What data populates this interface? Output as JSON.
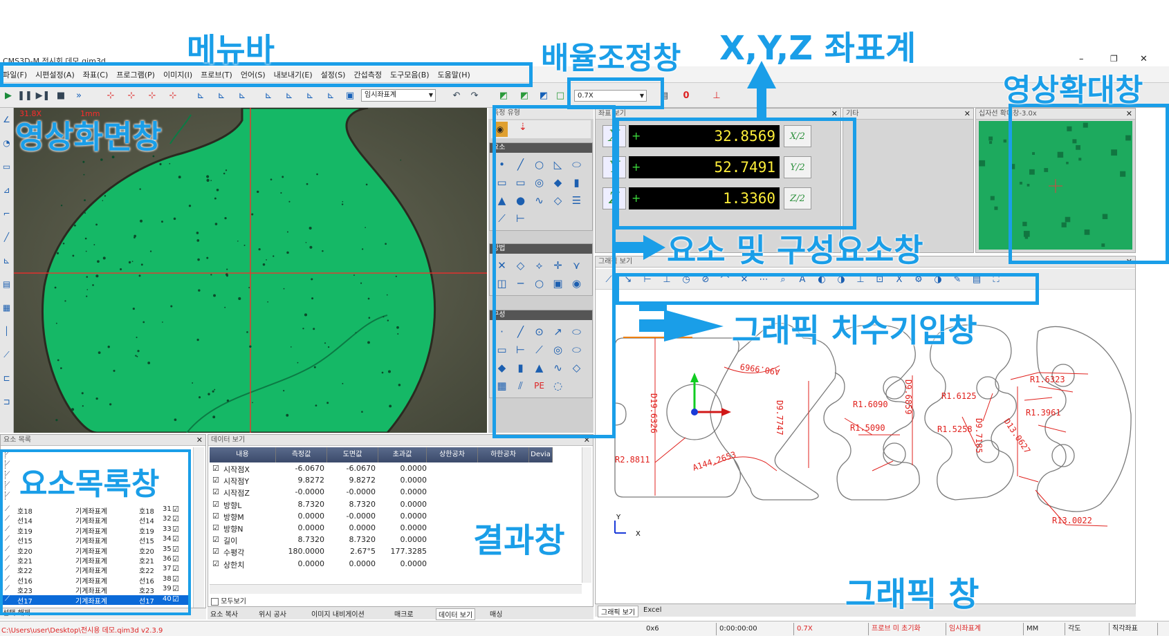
{
  "window": {
    "title": "CMS3D-M  전시회 데모.qim3d",
    "min": "–",
    "max": "❐",
    "close": "✕"
  },
  "menu": [
    "파일(F)",
    "시편설정(A)",
    "좌표(C)",
    "프로그램(P)",
    "이미지(I)",
    "프로브(T)",
    "언어(S)",
    "내보내기(E)",
    "설정(S)",
    "간섭측정",
    "도구모음(B)",
    "도움말(H)"
  ],
  "toolbar": {
    "coord_select": "임시좌표계",
    "zoom_select": "0.7X",
    "zero": "0"
  },
  "image_view": {
    "overlay_mag": "31.8X",
    "overlay_scale": "1mm"
  },
  "measure_panel": {
    "title": "측정 유형",
    "sec1": "요소",
    "sec2": "방법",
    "sec3": "구성",
    "pe": "PE"
  },
  "coord_panel": {
    "title": "좌표 보기",
    "rows": [
      {
        "axis": "X",
        "value": "32.8569",
        "half": "X/2"
      },
      {
        "axis": "Y",
        "value": "52.7491",
        "half": "Y/2"
      },
      {
        "axis": "Z",
        "value": "1.3360",
        "half": "Z/2"
      }
    ]
  },
  "etc_panel": {
    "title": "기타"
  },
  "zoom_panel": {
    "title": "십자선 확대창-3.0x"
  },
  "graphics_panel": {
    "title": "그래픽 보기",
    "dims": {
      "d1": "D19.6326",
      "r1": "R2.8811",
      "a1": "A144.2653",
      "a2": "A90.9969",
      "d2": "D9.7747",
      "r2": "R1.6090",
      "r3": "R1.5090",
      "d3": "D9.6859",
      "r4": "R1.6125",
      "r5": "R1.5258",
      "d4": "D9.7185",
      "d5": "D13.0627",
      "r6": "R1.6323",
      "r7": "R1.3961",
      "r8": "R13.0022"
    },
    "axis_x": "X",
    "axis_y": "Y",
    "tabs": [
      "그래픽 보기",
      "Excel"
    ]
  },
  "element_list": {
    "title": "요소 목록",
    "rows": [
      {
        "name": "호18",
        "coord": "기계좌표계",
        "ref": "호18",
        "no": "31"
      },
      {
        "name": "선14",
        "coord": "기계좌표계",
        "ref": "선14",
        "no": "32"
      },
      {
        "name": "호19",
        "coord": "기계좌표계",
        "ref": "호19",
        "no": "33"
      },
      {
        "name": "선15",
        "coord": "기계좌표계",
        "ref": "선15",
        "no": "34"
      },
      {
        "name": "호20",
        "coord": "기계좌표계",
        "ref": "호20",
        "no": "35"
      },
      {
        "name": "호21",
        "coord": "기계좌표계",
        "ref": "호21",
        "no": "36"
      },
      {
        "name": "호22",
        "coord": "기계좌표계",
        "ref": "호22",
        "no": "37"
      },
      {
        "name": "선16",
        "coord": "기계좌표계",
        "ref": "선16",
        "no": "38"
      },
      {
        "name": "호23",
        "coord": "기계좌표계",
        "ref": "호23",
        "no": "39"
      },
      {
        "name": "선17",
        "coord": "기계좌표계",
        "ref": "선17",
        "no": "40"
      }
    ],
    "deselect": "선택 해제"
  },
  "data_panel": {
    "title": "데이터 보기",
    "headers": [
      "내용",
      "측정값",
      "도면값",
      "초과값",
      "상한공차",
      "하한공차",
      "Devia"
    ],
    "rows": [
      [
        "시작점X",
        "-6.0670",
        "-6.0670",
        "0.0000"
      ],
      [
        "시작점Y",
        "9.8272",
        "9.8272",
        "0.0000"
      ],
      [
        "시작점Z",
        "-0.0000",
        "-0.0000",
        "0.0000"
      ],
      [
        "방향L",
        "8.7320",
        "8.7320",
        "0.0000"
      ],
      [
        "방향M",
        "0.0000",
        "-0.0000",
        "0.0000"
      ],
      [
        "방향N",
        "0.0000",
        "0.0000",
        "0.0000"
      ],
      [
        "길이",
        "8.7320",
        "8.7320",
        "0.0000"
      ],
      [
        "수평각",
        "180.0000",
        "2.67°5",
        "177.3285"
      ],
      [
        "상한치",
        "0.0000",
        "0.0000",
        "0.0000"
      ]
    ],
    "show_all": "모두보기",
    "tabs": [
      "요소 복사",
      "위시 공사",
      "이미지 내비게이션",
      "매크로",
      "데이터 보기",
      "매싱"
    ]
  },
  "statusbar": {
    "path": "C:\\Users\\user\\Desktop\\전시용 데모.qim3d v2.3.9",
    "cells": [
      "0x6",
      "0:00:00:00",
      "0.7X",
      "프로브 미 초기화",
      "임시좌표계",
      "MM",
      "각도",
      "직각좌표"
    ]
  },
  "annotations": {
    "menubar": "메뉴바",
    "zoom_window": "배율조정창",
    "xyz": "X,Y,Z 좌표계",
    "image_zoom": "영상확대창",
    "image_screen": "영상화면창",
    "elements": "요소 및 구성요소창",
    "dim_input": "그래픽 치수기입창",
    "elem_list": "요소목록창",
    "result": "결과창",
    "graphic": "그래픽 창"
  },
  "colors": {
    "accent": "#1a9ee8",
    "green_view": "#15b866",
    "dim_red": "#e0201c"
  }
}
